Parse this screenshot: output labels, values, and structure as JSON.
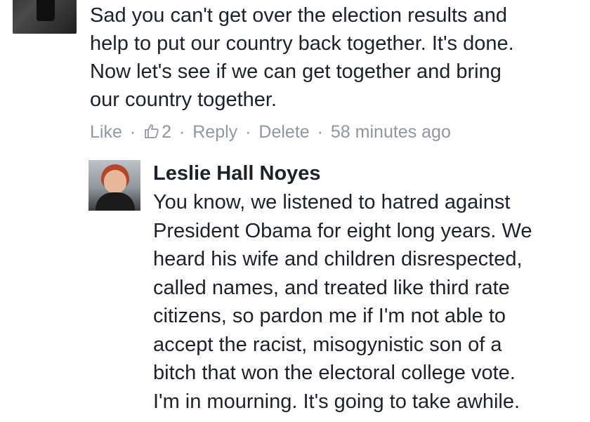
{
  "comment": {
    "text": "Sad you can't get over the election results and\nhelp to put our country back together. It's done.\nNow let's see if we can get together and bring\nour country together.",
    "actions": {
      "like_label": "Like",
      "like_count": "2",
      "reply_label": "Reply",
      "delete_label": "Delete",
      "timestamp": "58 minutes ago",
      "separator": "·"
    }
  },
  "reply": {
    "author": "Leslie Hall Noyes",
    "text": "You know, we listened to hatred against\nPresident Obama for eight long years. We\nheard his wife and children disrespected,\ncalled names, and treated like third rate\ncitizens, so pardon me if I'm not able to\naccept the racist, misogynistic son of a\nbitch that won the electoral college vote.\nI'm in mourning. It's going to take awhile."
  },
  "colors": {
    "text": "#1d2129",
    "meta": "#90949c",
    "link": "#9197a3"
  },
  "icons": {
    "like": "thumbs-up-icon"
  }
}
